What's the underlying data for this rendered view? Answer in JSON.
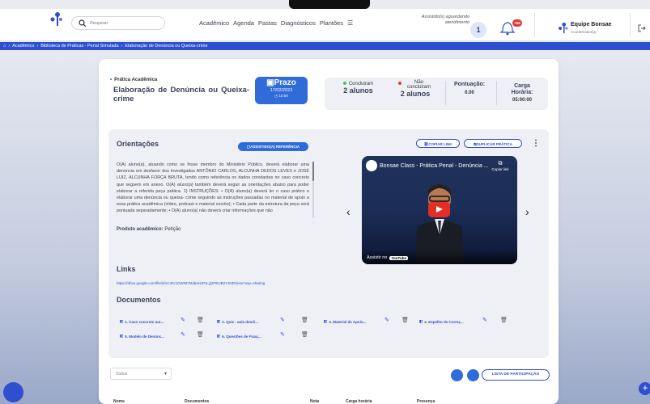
{
  "header": {
    "search_placeholder": "Pesquisar",
    "nav": [
      "Acadêmico",
      "Agenda",
      "Pastas",
      "Diagnósticos",
      "Plantões"
    ],
    "assist_text": "Assistido(s) aguardando atendimento",
    "assist_count": "1",
    "notif_count": "+99",
    "user_name": "Equipe Bonsae",
    "user_role": "Coordenador(a)"
  },
  "breadcrumb": [
    "Acadêmico",
    "Biblioteca de Práticas - Penal Simulada",
    "Elaboração de Denúncia ou Queixa-crime"
  ],
  "practice": {
    "kind": "Prática Acadêmica",
    "title": "Elaboração de Denúncia ou Queixa-crime",
    "prazo_label": "Prazo",
    "prazo_date": "17/02/2023",
    "prazo_time": "10:00"
  },
  "stats": {
    "concluiram_label": "Concluiram",
    "concluiram_value": "2 alunos",
    "nao_concluiram_label": "Não concluiram",
    "nao_concluiram_value": "2 alunos",
    "pontuacao_label": "Pontuação:",
    "pontuacao_value": "0.00",
    "carga_label": "Carga Horária:",
    "carga_value": "05:00:00"
  },
  "orientacoes": {
    "title": "Orientações",
    "ref_button": "ASSISTIDO(A) REFERÊNCIA",
    "copy_link": "COPIAR LINK",
    "duplicate": "DUPLICAR PRÁTICA",
    "text": "O(A) aluno(a), atuando como se fosse membro do Ministério Público, deverá elaborar uma denúncia em desfavor dos investigados ANTÔNIO CARLOS, ALCUNHA DEDOS LEVES e JOSÉ LUIZ, ALCUNHA FORÇA BRUTA, tendo como referência os dados constantes no caso concreto que seguem em anexo. O(A) aluno(a) também deverá seguir as orientações abaixo para poder elaborar a referida peça prática. 1) INSTRUÇÕES: • O(A) aluno(a) deverá ler o caso prático e elaborar uma denúncia ou queixa- crime seguindo as instruções passadas no material de apoio a essa prática acadêmica (vídeo, podcast e material escrito); • Cada parte da estrutura da peça será pontuada separadamente; • O(A) aluno(a) não deverá criar informações que não",
    "produto_label": "Produto acadêmico:",
    "produto_value": "Petição"
  },
  "video": {
    "title": "Bonsae Class - Prática Penal - Denúncia ...",
    "copy": "Copiar link",
    "watch": "Assistir no",
    "yt": "YouTube"
  },
  "links": {
    "title": "Links",
    "url": "https://drive.google.com/file/d/1C4hc1DWNt7M/jbxkUPsLyj2PEUB2YJND/view?usp=sharing"
  },
  "documentos": {
    "title": "Documentos",
    "items": [
      "1. Caso concreto aut...",
      "2. Quiz - aula demô...",
      "3. Material de Apoio...",
      "4. Espelho de Correç...",
      "5. Modelo de Denúnc...",
      "6. Questões de Fixaç..."
    ]
  },
  "footer": {
    "status_placeholder": "Status",
    "lista_button": "LISTA DE PARTICIPAÇÃO",
    "columns": [
      "Nome",
      "Documentos",
      "Nota",
      "Carga horária",
      "Presença"
    ]
  },
  "colors": {
    "primary": "#2f4fd1",
    "accent": "#2f6bd9",
    "badge": "#e53935"
  }
}
